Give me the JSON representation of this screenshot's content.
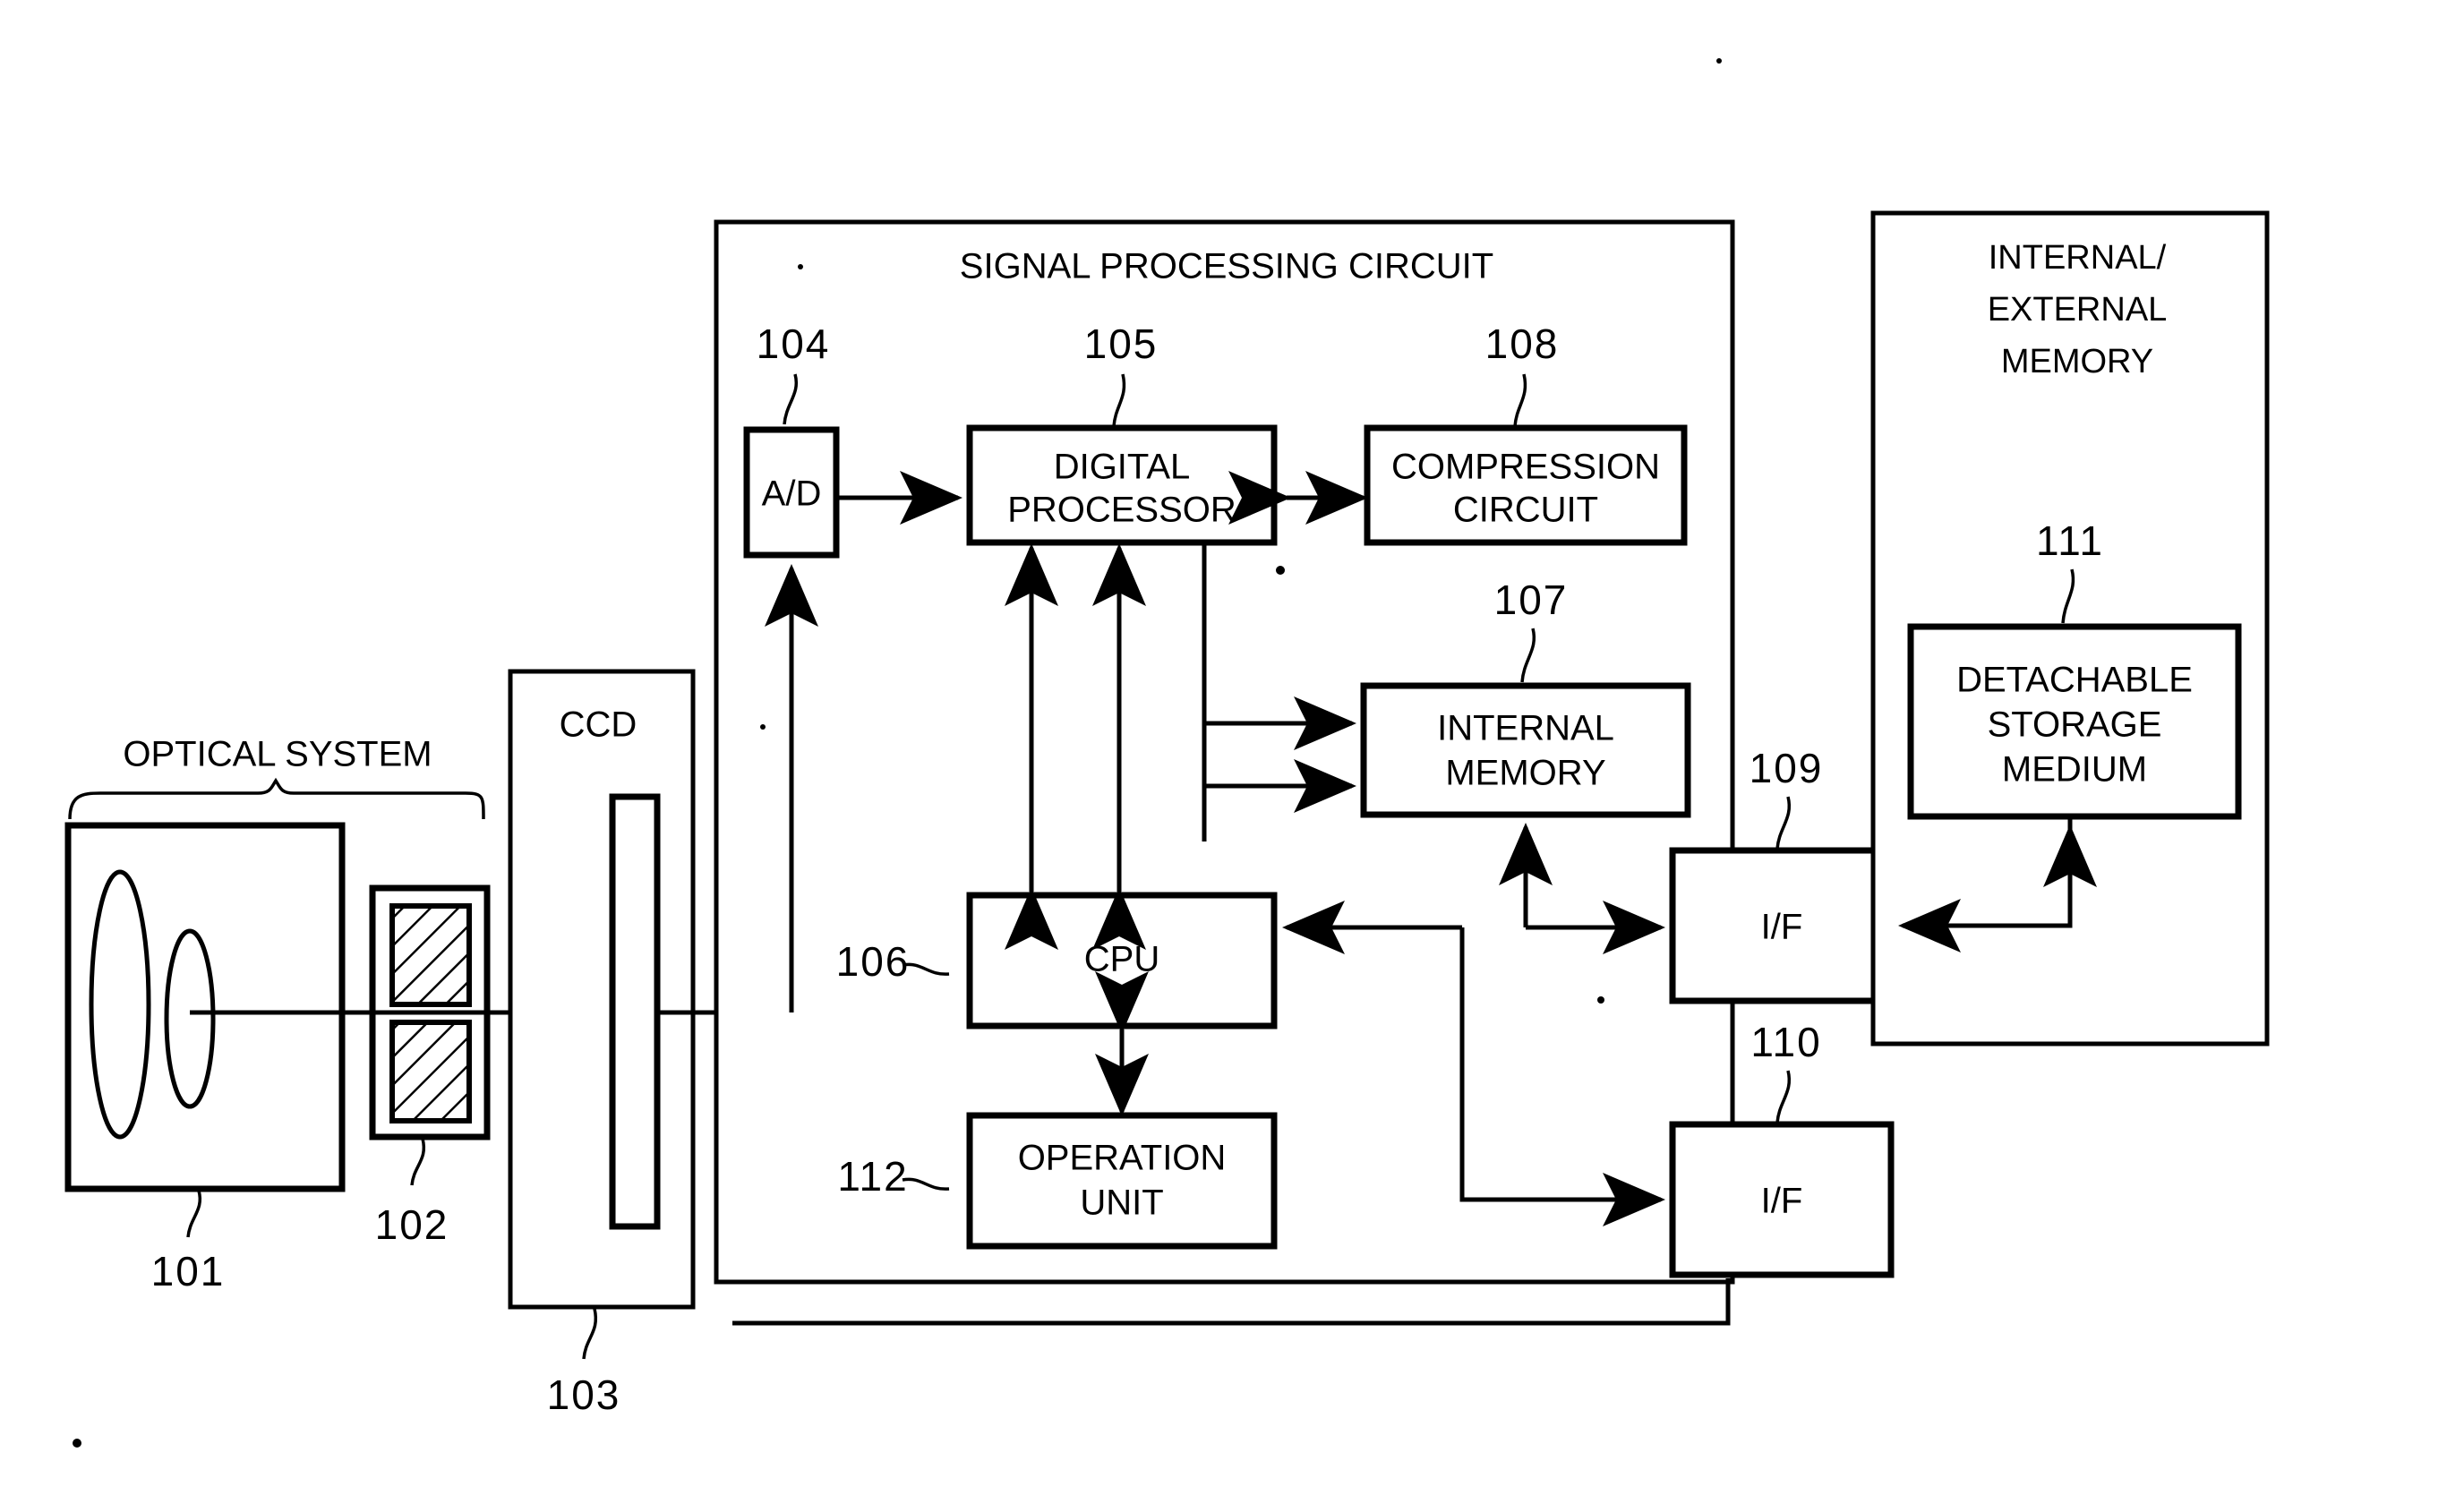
{
  "figure": {
    "kind": "block-diagram",
    "subject": "digital camera signal processing block diagram",
    "background_color": "#ffffff",
    "line_color": "#000000"
  },
  "groups": {
    "optical_system": {
      "label": "OPTICAL SYSTEM",
      "ref": "101",
      "shutter_ref": "102"
    },
    "ccd_module": {
      "label": "CCD",
      "ref": "103"
    },
    "signal_processing_circuit": {
      "title": "SIGNAL PROCESSING CIRCUIT"
    },
    "memory_module": {
      "title_line1": "INTERNAL/",
      "title_line2": "EXTERNAL",
      "title_line3": "MEMORY"
    }
  },
  "blocks": [
    {
      "id": "ad",
      "ref": "104",
      "label_line1": "A/D",
      "label_line2": ""
    },
    {
      "id": "digital",
      "ref": "105",
      "label_line1": "DIGITAL",
      "label_line2": "PROCESSOR"
    },
    {
      "id": "compression",
      "ref": "108",
      "label_line1": "COMPRESSION",
      "label_line2": "CIRCUIT"
    },
    {
      "id": "internalmem",
      "ref": "107",
      "label_line1": "INTERNAL",
      "label_line2": "MEMORY"
    },
    {
      "id": "cpu",
      "ref": "106",
      "label_line1": "CPU",
      "label_line2": ""
    },
    {
      "id": "operation",
      "ref": "112",
      "label_line1": "OPERATION",
      "label_line2": "UNIT"
    },
    {
      "id": "if1",
      "ref": "109",
      "label_line1": "I/F",
      "label_line2": ""
    },
    {
      "id": "if2",
      "ref": "110",
      "label_line1": "I/F",
      "label_line2": ""
    },
    {
      "id": "detachable",
      "ref": "111",
      "label_line1": "DETACHABLE",
      "label_line2": "STORAGE",
      "label_line3": "MEDIUM"
    }
  ],
  "reference_numerals": [
    "101",
    "102",
    "103",
    "104",
    "105",
    "106",
    "107",
    "108",
    "109",
    "110",
    "111",
    "112"
  ]
}
